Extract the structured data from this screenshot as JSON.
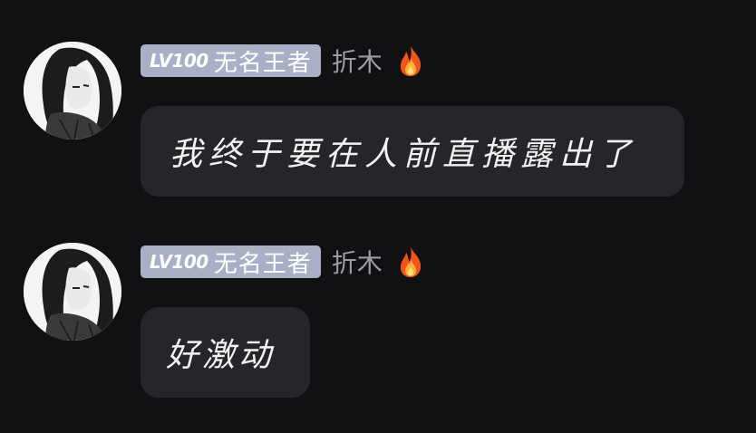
{
  "messages": [
    {
      "badge_level": "LV100",
      "badge_title": "无名王者",
      "username": "折木",
      "avatar_icon": "anime-girl-avatar-icon",
      "status_icon": "fire-icon",
      "text": "我终于要在人前直播露出了"
    },
    {
      "badge_level": "LV100",
      "badge_title": "无名王者",
      "username": "折木",
      "avatar_icon": "anime-girl-avatar-icon",
      "status_icon": "fire-icon",
      "text": "好激动"
    }
  ],
  "colors": {
    "background": "#111114",
    "bubble": "#26262a",
    "badge": "#a9b0c6",
    "username": "#9c9ca3",
    "message_text": "#f2f2f2"
  }
}
